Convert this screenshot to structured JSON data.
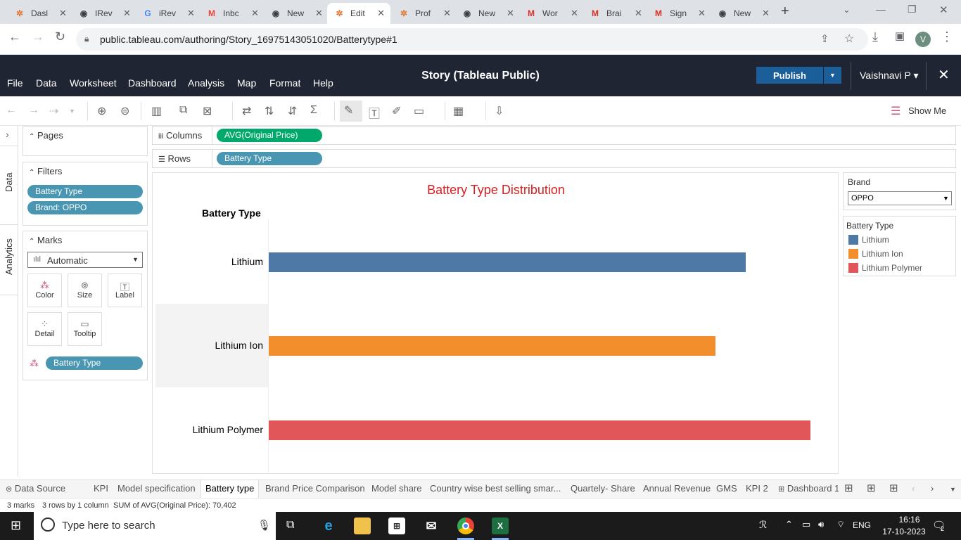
{
  "browser": {
    "tabs": [
      {
        "title": "Dasl",
        "icon": "tableau-icon"
      },
      {
        "title": "IRev",
        "icon": "globe-icon"
      },
      {
        "title": "iRev",
        "icon": "google-icon"
      },
      {
        "title": "Inbc",
        "icon": "gmail-icon"
      },
      {
        "title": "New",
        "icon": "chrome-icon"
      },
      {
        "title": "Edit",
        "icon": "tableau-icon"
      },
      {
        "title": "Prof",
        "icon": "tableau-icon"
      },
      {
        "title": "New",
        "icon": "chrome-icon"
      },
      {
        "title": "Wor",
        "icon": "m-icon"
      },
      {
        "title": "Brai",
        "icon": "m-icon"
      },
      {
        "title": "Sign",
        "icon": "m-icon"
      },
      {
        "title": "New",
        "icon": "chrome-icon"
      }
    ],
    "url": "public.tableau.com/authoring/Story_16975143051020/Batterytype#1",
    "profile_initial": "V"
  },
  "app": {
    "menus": [
      "File",
      "Data",
      "Worksheet",
      "Dashboard",
      "Analysis",
      "Map",
      "Format",
      "Help"
    ],
    "title": "Story (Tableau Public)",
    "publish_label": "Publish",
    "user": "Vaishnavi P ▾",
    "show_me": "Show Me"
  },
  "sidepanel": {
    "data_tab": "Data",
    "analytics_tab": "Analytics",
    "pages_label": "Pages",
    "filters_label": "Filters",
    "filters": [
      "Battery Type",
      "Brand: OPPO"
    ],
    "marks_label": "Marks",
    "mark_type": "Automatic",
    "mark_buttons": [
      "Color",
      "Size",
      "Label",
      "Detail",
      "Tooltip"
    ],
    "color_pill": "Battery Type"
  },
  "shelves": {
    "columns_label": "Columns",
    "columns_pill": "AVG(Original Price)",
    "rows_label": "Rows",
    "rows_pill": "Battery Type"
  },
  "chart_data": {
    "type": "bar",
    "title": "Battery Type Distribution",
    "row_header": "Battery Type",
    "categories": [
      "Lithium",
      "Lithium Ion",
      "Lithium Polymer"
    ],
    "values": [
      88.0,
      82.5,
      100.0
    ],
    "value_note_units": "relative bar length (percent of longest), axis not shown",
    "colors": [
      "#4e79a7",
      "#f28e2b",
      "#e15759"
    ]
  },
  "filters_card": {
    "title": "Brand",
    "value": "OPPO"
  },
  "legend": {
    "title": "Battery Type",
    "items": [
      {
        "label": "Lithium",
        "color": "#4e79a7"
      },
      {
        "label": "Lithium Ion",
        "color": "#f28e2b"
      },
      {
        "label": "Lithium Polymer",
        "color": "#e15759"
      }
    ]
  },
  "sheet_tabs": [
    "Data Source",
    "KPI",
    "Model specification",
    "Battery type",
    "Brand Price Comparison",
    "Model share",
    "Country wise best selling smar...",
    "Quartely- Share",
    "Annual Revenue",
    "GMS",
    "KPI 2",
    "Dashboard 1"
  ],
  "active_sheet": "Battery type",
  "status": {
    "marks": "3 marks",
    "rows_cols": "3 rows by 1 column",
    "sum": "SUM of AVG(Original Price): 70,402"
  },
  "taskbar": {
    "search_placeholder": "Type here to search",
    "language": "ENG",
    "time": "16:16",
    "date": "17-10-2023",
    "notifications": "2"
  }
}
